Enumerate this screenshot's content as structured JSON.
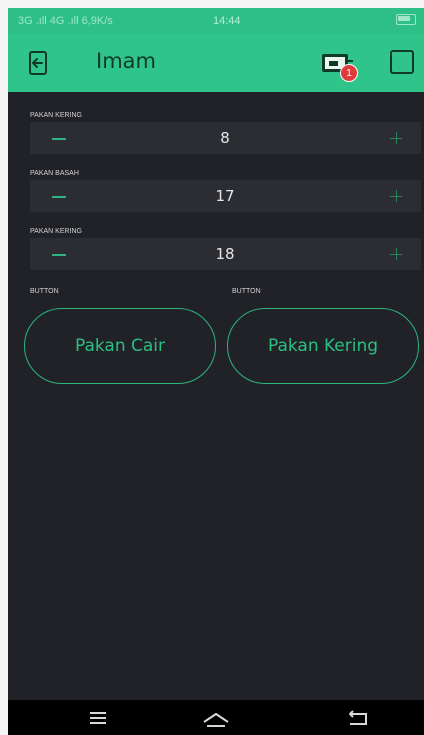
{
  "status_bar": {
    "left_text": "3G .ıll 4G .ıll 6,9K/s",
    "time": "14:44",
    "network_speed": "6,9K/s"
  },
  "header": {
    "title": "Imam",
    "notification_count": "1",
    "colors": {
      "accent": "#2fc48a",
      "dark_icon": "#0f3a2a"
    }
  },
  "icons": {
    "back": "exit-icon",
    "device": "device-icon",
    "badge": "notification-badge",
    "square": "square-icon",
    "menu": "menu-icon",
    "home": "home-icon",
    "back_nav": "back-icon"
  },
  "steppers": [
    {
      "label": "PAKAN KERING",
      "value": "8"
    },
    {
      "label": "PAKAN BASAH",
      "value": "17"
    },
    {
      "label": "PAKAN KERING",
      "value": "18"
    }
  ],
  "buttons": [
    {
      "label": "BUTTON",
      "text": "Pakan Cair"
    },
    {
      "label": "BUTTON",
      "text": "Pakan Kering"
    }
  ],
  "colors": {
    "background": "#212227",
    "stepper_bg": "#2c2d33",
    "button_outline": "#2bb57c",
    "text": "#e6e6e6"
  }
}
